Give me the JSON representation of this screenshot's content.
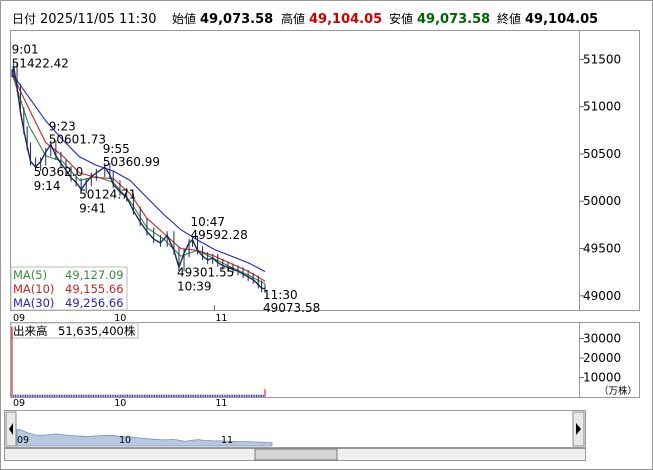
{
  "header": {
    "date_label": "日付",
    "datetime": "2025/11/05 11:30",
    "open_label": "始値",
    "open": "49,073.58",
    "high_label": "高値",
    "high": "49,104.05",
    "low_label": "安値",
    "low": "49,073.58",
    "close_label": "終値",
    "close": "49,104.05",
    "colors": {
      "open": "#000000",
      "high": "#cc0000",
      "low": "#006600",
      "close": "#000000"
    }
  },
  "ma_legend": [
    {
      "label": "MA(5)",
      "value": "49,127.09",
      "color": "#3a8a3a"
    },
    {
      "label": "MA(10)",
      "value": "49,155.66",
      "color": "#cc2222"
    },
    {
      "label": "MA(30)",
      "value": "49,256.66",
      "color": "#2222cc"
    }
  ],
  "volume_legend": {
    "label": "出来高",
    "value": "51,635,400株"
  },
  "volume_unit": "（万株）",
  "colors": {
    "ma5": "#3a8a3a",
    "ma10": "#cc2222",
    "ma30": "#2222cc",
    "volume": "#3333aa",
    "volume_last": "#cc0000",
    "overview_fill": "#b8c8e0"
  },
  "chart_data": [
    {
      "type": "line",
      "title": "",
      "x_ticks": [
        "09",
        "10",
        "11"
      ],
      "y_ticks": [
        51500,
        51000,
        50500,
        50000,
        49500,
        49000
      ],
      "ylim": [
        48850,
        51800
      ],
      "grid": false,
      "time_range": [
        "09:00",
        "11:30"
      ],
      "price_series": {
        "time": [
          "09:00",
          "09:01",
          "09:03",
          "09:05",
          "09:07",
          "09:09",
          "09:11",
          "09:14",
          "09:17",
          "09:20",
          "09:23",
          "09:26",
          "09:29",
          "09:32",
          "09:35",
          "09:38",
          "09:41",
          "09:44",
          "09:47",
          "09:50",
          "09:55",
          "09:58",
          "10:00",
          "10:04",
          "10:08",
          "10:12",
          "10:16",
          "10:20",
          "10:24",
          "10:28",
          "10:32",
          "10:36",
          "10:39",
          "10:42",
          "10:45",
          "10:47",
          "10:50",
          "10:53",
          "10:56",
          "10:59",
          "11:02",
          "11:05",
          "11:08",
          "11:11",
          "11:14",
          "11:17",
          "11:20",
          "11:23",
          "11:26",
          "11:28",
          "11:30"
        ],
        "price": [
          51350,
          51422,
          51200,
          50950,
          50750,
          50580,
          50420,
          50362,
          50420,
          50520,
          50600,
          50480,
          50400,
          50330,
          50250,
          50200,
          50125,
          50200,
          50260,
          50300,
          50361,
          50280,
          50180,
          50100,
          50040,
          49900,
          49780,
          49680,
          49600,
          49560,
          49640,
          49480,
          49302,
          49450,
          49560,
          49592,
          49480,
          49420,
          49380,
          49400,
          49350,
          49320,
          49300,
          49280,
          49260,
          49230,
          49200,
          49170,
          49120,
          49080,
          49074
        ]
      },
      "ma_series": [
        {
          "name": "MA(5)",
          "time": [
            "09:00",
            "09:10",
            "09:20",
            "09:30",
            "09:40",
            "09:50",
            "10:00",
            "10:10",
            "10:20",
            "10:30",
            "10:40",
            "10:50",
            "11:00",
            "11:10",
            "11:20",
            "11:30"
          ],
          "values": [
            51350,
            50800,
            50480,
            50420,
            50220,
            50260,
            50200,
            50000,
            49720,
            49600,
            49420,
            49480,
            49390,
            49300,
            49220,
            49127
          ]
        },
        {
          "name": "MA(10)",
          "time": [
            "09:00",
            "09:10",
            "09:20",
            "09:30",
            "09:40",
            "09:50",
            "10:00",
            "10:10",
            "10:20",
            "10:30",
            "10:40",
            "10:50",
            "11:00",
            "11:10",
            "11:20",
            "11:30"
          ],
          "values": [
            51350,
            50980,
            50620,
            50480,
            50300,
            50250,
            50240,
            50080,
            49820,
            49660,
            49500,
            49480,
            49420,
            49340,
            49260,
            49156
          ]
        },
        {
          "name": "MA(30)",
          "time": [
            "09:00",
            "09:10",
            "09:20",
            "09:30",
            "09:40",
            "09:50",
            "10:00",
            "10:10",
            "10:20",
            "10:30",
            "10:40",
            "10:50",
            "11:00",
            "11:10",
            "11:20",
            "11:30"
          ],
          "values": [
            51350,
            51100,
            50850,
            50650,
            50470,
            50380,
            50320,
            50220,
            50040,
            49860,
            49700,
            49590,
            49490,
            49420,
            49350,
            49257
          ]
        }
      ],
      "annotations": [
        {
          "time": "09:01",
          "value": 51422.42,
          "label_time": "9:01",
          "label_value": "51422.42",
          "position": "above"
        },
        {
          "time": "09:23",
          "value": 50601.73,
          "label_time": "9:23",
          "label_value": "50601.73",
          "position": "above"
        },
        {
          "time": "09:14",
          "value": 50362.0,
          "label_time": "9:14",
          "label_value": "50362.0",
          "position": "below"
        },
        {
          "time": "09:55",
          "value": 50360.99,
          "label_time": "9:55",
          "label_value": "50360.99",
          "position": "above"
        },
        {
          "time": "09:41",
          "value": 50124.71,
          "label_time": "9:41",
          "label_value": "50124.71",
          "position": "below"
        },
        {
          "time": "10:47",
          "value": 49592.28,
          "label_time": "10:47",
          "label_value": "49592.28",
          "position": "above"
        },
        {
          "time": "10:39",
          "value": 49301.55,
          "label_time": "10:39",
          "label_value": "49301.55",
          "position": "below"
        },
        {
          "time": "11:30",
          "value": 49073.58,
          "label_time": "11:30",
          "label_value": "49073.58",
          "position": "below"
        }
      ]
    },
    {
      "type": "bar",
      "title": "",
      "x_ticks": [
        "09",
        "10",
        "11"
      ],
      "y_ticks": [
        30000,
        20000,
        10000
      ],
      "ylim": [
        0,
        38000
      ],
      "first_bar_value": 36000,
      "typical_bar_value": 1200,
      "last_bar_value": 4000
    }
  ],
  "overview": {
    "x_ticks": [
      "09",
      "10",
      "11"
    ]
  }
}
